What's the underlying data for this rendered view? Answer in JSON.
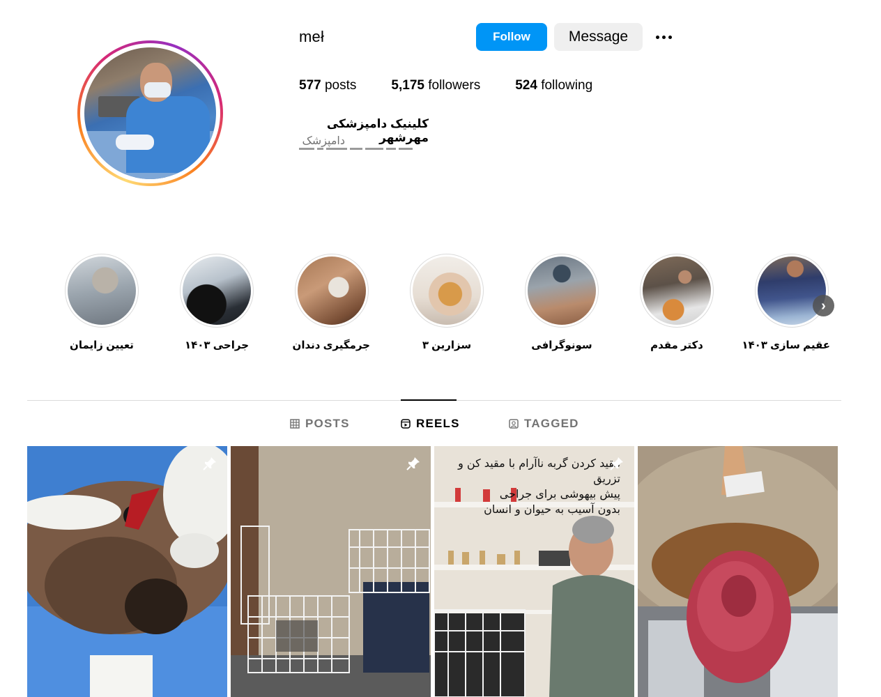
{
  "profile": {
    "username": "meł",
    "follow_label": "Follow",
    "message_label": "Message",
    "more_icon": "more-horizontal-icon",
    "stats": {
      "posts_count": "577",
      "posts_label": "posts",
      "followers_count": "5,175",
      "followers_label": "followers",
      "following_count": "524",
      "following_label": "following"
    },
    "bio": {
      "name": "کلینیک دامپزشکی مهرشهر",
      "category": "دامپزشک"
    }
  },
  "highlights": [
    {
      "label": "تعیین زایمان"
    },
    {
      "label": "جراحی ۱۴۰۳"
    },
    {
      "label": "جرمگیری دندان"
    },
    {
      "label": "سزارین ۳"
    },
    {
      "label": "سونوگرافی"
    },
    {
      "label": "دکتر مقدم"
    },
    {
      "label": "عقیم سازی ۱۴۰۳"
    }
  ],
  "tabs": {
    "posts": "POSTS",
    "reels": "REELS",
    "tagged": "TAGGED",
    "active": "reels"
  },
  "posts": [
    {
      "pinned": true
    },
    {
      "pinned": true
    },
    {
      "pinned": true,
      "overlay_lines": [
        "مقید کردن گربه ناآرام با مقید کن و تزریق",
        "پیش بیهوشی برای جراحی",
        "بدون آسیب به حیوان و انسان"
      ]
    },
    {
      "pinned": false
    }
  ],
  "colors": {
    "follow_bg": "#0095f6",
    "message_bg": "#efefef",
    "divider": "#dbdbdb",
    "muted_text": "#737373"
  }
}
